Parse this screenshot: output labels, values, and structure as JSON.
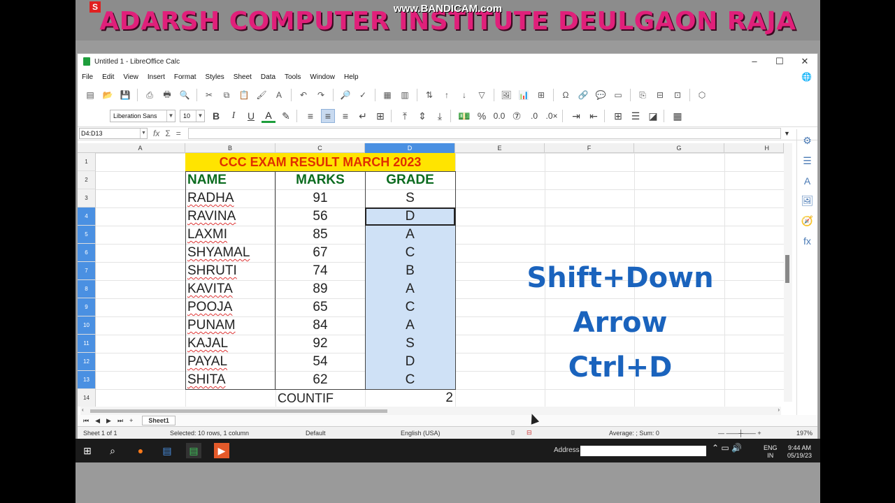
{
  "banner": {
    "title": "ADARSH COMPUTER INSTITUTE DEULGAON RAJA",
    "watermark": "www.BANDICAM.com",
    "corner_mark": "S"
  },
  "window": {
    "title": "Untitled 1 - LibreOffice Calc",
    "controls": [
      "–",
      "☐",
      "✕"
    ]
  },
  "menu": [
    "File",
    "Edit",
    "View",
    "Insert",
    "Format",
    "Styles",
    "Sheet",
    "Data",
    "Tools",
    "Window",
    "Help"
  ],
  "format_bar": {
    "font_name": "Liberation Sans",
    "font_size": "10"
  },
  "formula_bar": {
    "name_box": "D4:D13",
    "fx": "fx",
    "sum": "Σ",
    "equals": "="
  },
  "columns": [
    "A",
    "B",
    "C",
    "D",
    "E",
    "F",
    "G",
    "H"
  ],
  "rows": [
    "1",
    "2",
    "3",
    "4",
    "5",
    "6",
    "7",
    "8",
    "9",
    "10",
    "11",
    "12",
    "13",
    "14"
  ],
  "sheet": {
    "title": "CCC EXAM RESULT MARCH 2023",
    "headers": {
      "name": "NAME",
      "marks": "MARKS",
      "grade": "GRADE"
    },
    "records": [
      {
        "name": "RADHA",
        "marks": "91",
        "grade": "S"
      },
      {
        "name": "RAVINA",
        "marks": "56",
        "grade": "D"
      },
      {
        "name": "LAXMI",
        "marks": "85",
        "grade": "A"
      },
      {
        "name": "SHYAMAL",
        "marks": "67",
        "grade": "C"
      },
      {
        "name": "SHRUTI",
        "marks": "74",
        "grade": "B"
      },
      {
        "name": "KAVITA",
        "marks": "89",
        "grade": "A"
      },
      {
        "name": "POOJA",
        "marks": "65",
        "grade": "C"
      },
      {
        "name": "PUNAM",
        "marks": "84",
        "grade": "A"
      },
      {
        "name": "KAJAL",
        "marks": "92",
        "grade": "S"
      },
      {
        "name": "PAYAL",
        "marks": "54",
        "grade": "D"
      },
      {
        "name": "SHITA",
        "marks": "62",
        "grade": "C"
      }
    ],
    "footer_label": "COUNTIF",
    "footer_value": "2"
  },
  "overlay": {
    "line1": "Shift+Down",
    "line2": "Arrow",
    "line3": "Ctrl+D"
  },
  "tabs": {
    "nav": [
      "⏮",
      "◀",
      "▶",
      "⏭",
      "+"
    ],
    "sheet1": "Sheet1"
  },
  "status": {
    "sheet_of": "Sheet 1 of 1",
    "selection": "Selected: 10 rows, 1 column",
    "page_style": "Default",
    "language": "English (USA)",
    "sum": "Average: ; Sum: 0",
    "zoom": "197%"
  },
  "taskbar": {
    "address_label": "Address",
    "lang1": "ENG",
    "lang2": "IN",
    "time": "9:44 AM",
    "date": "05/19/23"
  },
  "colors": {
    "title_bg": "#ffe400",
    "title_fg": "#e02f00",
    "header_fg": "#0b6b1f",
    "overlay": "#1a63bd",
    "selection": "#cfe1f6",
    "banner": "#e0207a"
  }
}
